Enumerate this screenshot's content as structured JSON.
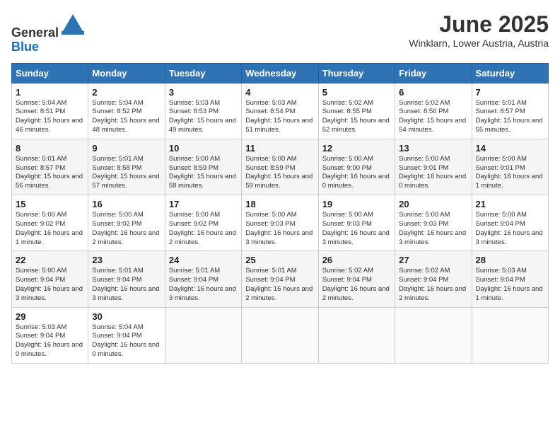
{
  "header": {
    "logo_line1": "General",
    "logo_line2": "Blue",
    "month": "June 2025",
    "location": "Winklarn, Lower Austria, Austria"
  },
  "weekdays": [
    "Sunday",
    "Monday",
    "Tuesday",
    "Wednesday",
    "Thursday",
    "Friday",
    "Saturday"
  ],
  "weeks": [
    [
      {
        "day": "1",
        "rise": "5:04 AM",
        "set": "8:51 PM",
        "daylight": "15 hours and 46 minutes."
      },
      {
        "day": "2",
        "rise": "5:04 AM",
        "set": "8:52 PM",
        "daylight": "15 hours and 48 minutes."
      },
      {
        "day": "3",
        "rise": "5:03 AM",
        "set": "8:53 PM",
        "daylight": "15 hours and 49 minutes."
      },
      {
        "day": "4",
        "rise": "5:03 AM",
        "set": "8:54 PM",
        "daylight": "15 hours and 51 minutes."
      },
      {
        "day": "5",
        "rise": "5:02 AM",
        "set": "8:55 PM",
        "daylight": "15 hours and 52 minutes."
      },
      {
        "day": "6",
        "rise": "5:02 AM",
        "set": "8:56 PM",
        "daylight": "15 hours and 54 minutes."
      },
      {
        "day": "7",
        "rise": "5:01 AM",
        "set": "8:57 PM",
        "daylight": "15 hours and 55 minutes."
      }
    ],
    [
      {
        "day": "8",
        "rise": "5:01 AM",
        "set": "8:57 PM",
        "daylight": "15 hours and 56 minutes."
      },
      {
        "day": "9",
        "rise": "5:01 AM",
        "set": "8:58 PM",
        "daylight": "15 hours and 57 minutes."
      },
      {
        "day": "10",
        "rise": "5:00 AM",
        "set": "8:59 PM",
        "daylight": "15 hours and 58 minutes."
      },
      {
        "day": "11",
        "rise": "5:00 AM",
        "set": "8:59 PM",
        "daylight": "15 hours and 59 minutes."
      },
      {
        "day": "12",
        "rise": "5:00 AM",
        "set": "9:00 PM",
        "daylight": "16 hours and 0 minutes."
      },
      {
        "day": "13",
        "rise": "5:00 AM",
        "set": "9:01 PM",
        "daylight": "16 hours and 0 minutes."
      },
      {
        "day": "14",
        "rise": "5:00 AM",
        "set": "9:01 PM",
        "daylight": "16 hours and 1 minute."
      }
    ],
    [
      {
        "day": "15",
        "rise": "5:00 AM",
        "set": "9:02 PM",
        "daylight": "16 hours and 1 minute."
      },
      {
        "day": "16",
        "rise": "5:00 AM",
        "set": "9:02 PM",
        "daylight": "16 hours and 2 minutes."
      },
      {
        "day": "17",
        "rise": "5:00 AM",
        "set": "9:02 PM",
        "daylight": "16 hours and 2 minutes."
      },
      {
        "day": "18",
        "rise": "5:00 AM",
        "set": "9:03 PM",
        "daylight": "16 hours and 3 minutes."
      },
      {
        "day": "19",
        "rise": "5:00 AM",
        "set": "9:03 PM",
        "daylight": "16 hours and 3 minutes."
      },
      {
        "day": "20",
        "rise": "5:00 AM",
        "set": "9:03 PM",
        "daylight": "16 hours and 3 minutes."
      },
      {
        "day": "21",
        "rise": "5:00 AM",
        "set": "9:04 PM",
        "daylight": "16 hours and 3 minutes."
      }
    ],
    [
      {
        "day": "22",
        "rise": "5:00 AM",
        "set": "9:04 PM",
        "daylight": "16 hours and 3 minutes."
      },
      {
        "day": "23",
        "rise": "5:01 AM",
        "set": "9:04 PM",
        "daylight": "16 hours and 3 minutes."
      },
      {
        "day": "24",
        "rise": "5:01 AM",
        "set": "9:04 PM",
        "daylight": "16 hours and 3 minutes."
      },
      {
        "day": "25",
        "rise": "5:01 AM",
        "set": "9:04 PM",
        "daylight": "16 hours and 2 minutes."
      },
      {
        "day": "26",
        "rise": "5:02 AM",
        "set": "9:04 PM",
        "daylight": "16 hours and 2 minutes."
      },
      {
        "day": "27",
        "rise": "5:02 AM",
        "set": "9:04 PM",
        "daylight": "16 hours and 2 minutes."
      },
      {
        "day": "28",
        "rise": "5:03 AM",
        "set": "9:04 PM",
        "daylight": "16 hours and 1 minute."
      }
    ],
    [
      {
        "day": "29",
        "rise": "5:03 AM",
        "set": "9:04 PM",
        "daylight": "16 hours and 0 minutes."
      },
      {
        "day": "30",
        "rise": "5:04 AM",
        "set": "9:04 PM",
        "daylight": "16 hours and 0 minutes."
      },
      null,
      null,
      null,
      null,
      null
    ]
  ]
}
